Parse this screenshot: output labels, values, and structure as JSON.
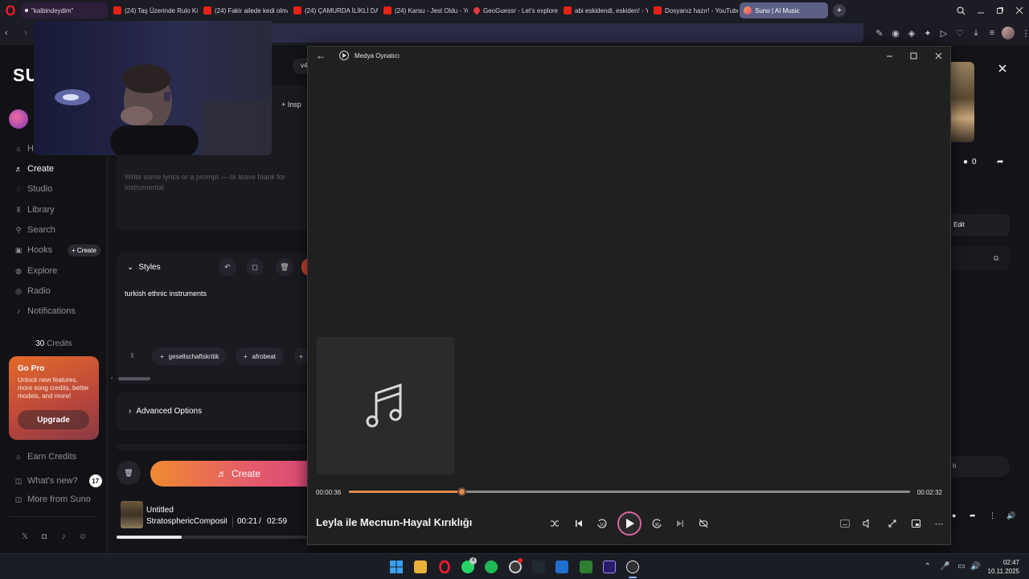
{
  "browser": {
    "tabs": [
      {
        "label": "\"kalbindeydim\"",
        "favicon": "dot-icon"
      },
      {
        "label": "(24) Taş Üzerinde Rulo Köf",
        "favicon": "youtube-icon"
      },
      {
        "label": "(24) Fakir ailede kedi olma",
        "favicon": "youtube-icon"
      },
      {
        "label": "(24) ÇAMURDA İLİKLİ DAN",
        "favicon": "youtube-icon"
      },
      {
        "label": "(24) Karsu - Jest Oldu - Yo",
        "favicon": "youtube-icon"
      },
      {
        "label": "GeoGuessr - Let's explore",
        "favicon": "geoguessr-icon"
      },
      {
        "label": "abi eskidendi, eskiden! - Y",
        "favicon": "youtube-icon"
      },
      {
        "label": "Dosyanız hazır! - YouTube",
        "favicon": "youtube-icon"
      },
      {
        "label": "Suno | AI Music",
        "favicon": "suno-icon",
        "active": true
      }
    ],
    "new_tab": "+"
  },
  "suno": {
    "sidebar": {
      "nav": [
        {
          "label": "Home",
          "icon": "home-icon"
        },
        {
          "label": "Create",
          "icon": "music-note-icon",
          "active": true
        },
        {
          "label": "Studio",
          "icon": "studio-icon"
        },
        {
          "label": "Library",
          "icon": "library-icon"
        },
        {
          "label": "Search",
          "icon": "search-icon"
        },
        {
          "label": "Hooks",
          "icon": "hooks-icon"
        },
        {
          "label": "Explore",
          "icon": "explore-icon"
        },
        {
          "label": "Radio",
          "icon": "radio-icon"
        },
        {
          "label": "Notifications",
          "icon": "bell-icon"
        }
      ],
      "hooks_create": "+ Create",
      "credits_count": "30",
      "credits_label": "Credits",
      "gopro": {
        "title": "Go Pro",
        "text": "Unlock new features, more song credits, better models, and more!",
        "button": "Upgrade"
      },
      "footer_nav": [
        {
          "label": "Earn Credits",
          "icon": "earn-icon"
        },
        {
          "label": "What's new?",
          "icon": "whats-new-icon",
          "badge": "17"
        },
        {
          "label": "More from Suno",
          "icon": "more-icon"
        }
      ]
    },
    "create_panel": {
      "version": "v4",
      "inspo_label": "Insp",
      "lyrics_placeholder": "Write some lyrics or a prompt — or leave blank for instrumental",
      "styles_label": "Styles",
      "styles_value": "turkish ethnic instruments",
      "chips": [
        "gesellschaftskritik",
        "afrobeat"
      ],
      "advanced_label": "Advanced Options",
      "create_button": "Create"
    },
    "right_panel": {
      "comments_count": "0",
      "edit_label": "Edit"
    },
    "player": {
      "title": "Untitled",
      "artist": "StratosphericCompositio",
      "current_time": "00:21",
      "separator": "/",
      "total_time": "02:59",
      "progress": 0.12
    }
  },
  "media_player": {
    "app_title": "Medya Oynatıcı",
    "song_title": "Leyla ile Mecnun-Hayal Kırıklığı",
    "elapsed": "00:00:36",
    "duration": "00:02:32",
    "progress": 0.2
  },
  "taskbar": {
    "time": "02:47",
    "date": "10.11.2025",
    "whatsapp_badge": "4"
  },
  "colors": {
    "accent_orange": "#e08a4a",
    "suno_gradient_start": "#f08a30",
    "suno_gradient_end": "#d8447a",
    "active_tab": "#5b5f86"
  }
}
